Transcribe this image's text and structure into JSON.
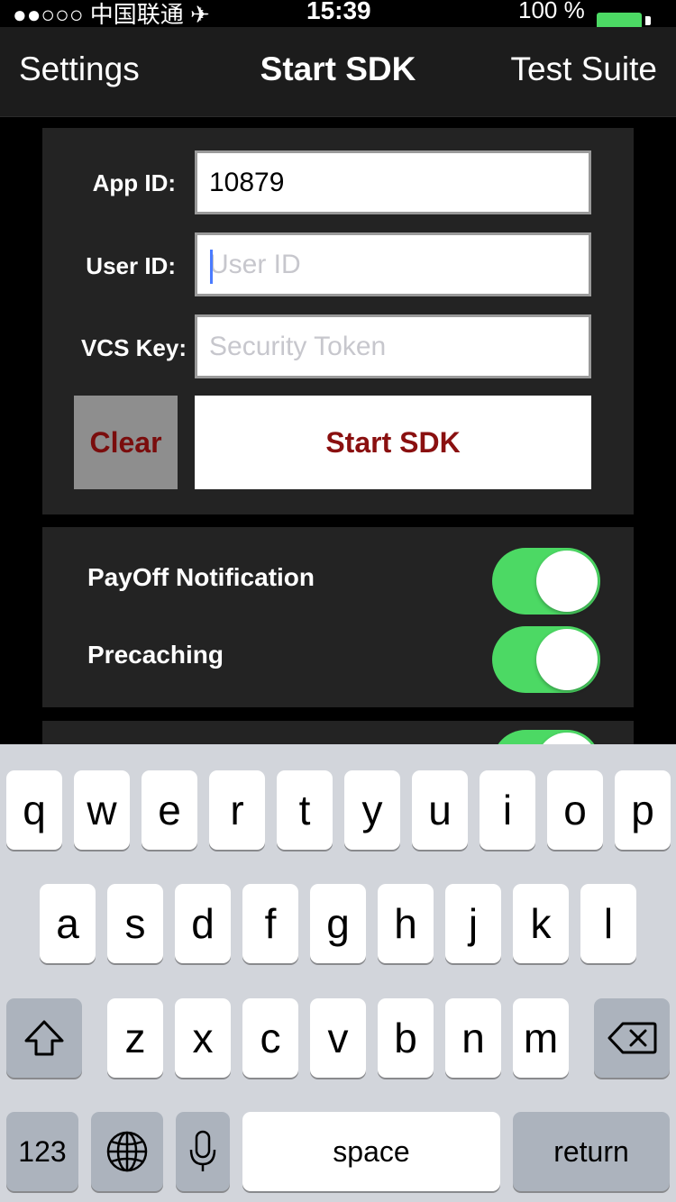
{
  "status_bar": {
    "carrier": "●●○○○ 中国联通 ✈",
    "time": "15:39",
    "battery_percent": "100 %",
    "battery_color": "#4cd964"
  },
  "nav": {
    "left_label": "Settings",
    "title": "Start SDK",
    "right_label": "Test Suite"
  },
  "form": {
    "app_id_label": "App ID:",
    "app_id_value": "10879",
    "user_id_label": "User ID:",
    "user_id_placeholder": "User ID",
    "vcs_key_label": "VCS Key:",
    "vcs_key_placeholder": "Security Token",
    "clear_label": "Clear",
    "start_label": "Start SDK"
  },
  "toggles": [
    {
      "label": "PayOff Notification",
      "on": true
    },
    {
      "label": "Precaching",
      "on": true
    }
  ],
  "keyboard": {
    "row1": [
      "q",
      "w",
      "e",
      "r",
      "t",
      "y",
      "u",
      "i",
      "o",
      "p"
    ],
    "row2": [
      "a",
      "s",
      "d",
      "f",
      "g",
      "h",
      "j",
      "k",
      "l"
    ],
    "row3": [
      "z",
      "x",
      "c",
      "v",
      "b",
      "n",
      "m"
    ],
    "numbers_label": "123",
    "space_label": "space",
    "return_label": "return",
    "icons": [
      "shift-icon",
      "delete-icon",
      "globe-icon",
      "microphone-icon"
    ]
  },
  "colors": {
    "toggle_on": "#4cd964",
    "button_text": "#8a1010"
  }
}
